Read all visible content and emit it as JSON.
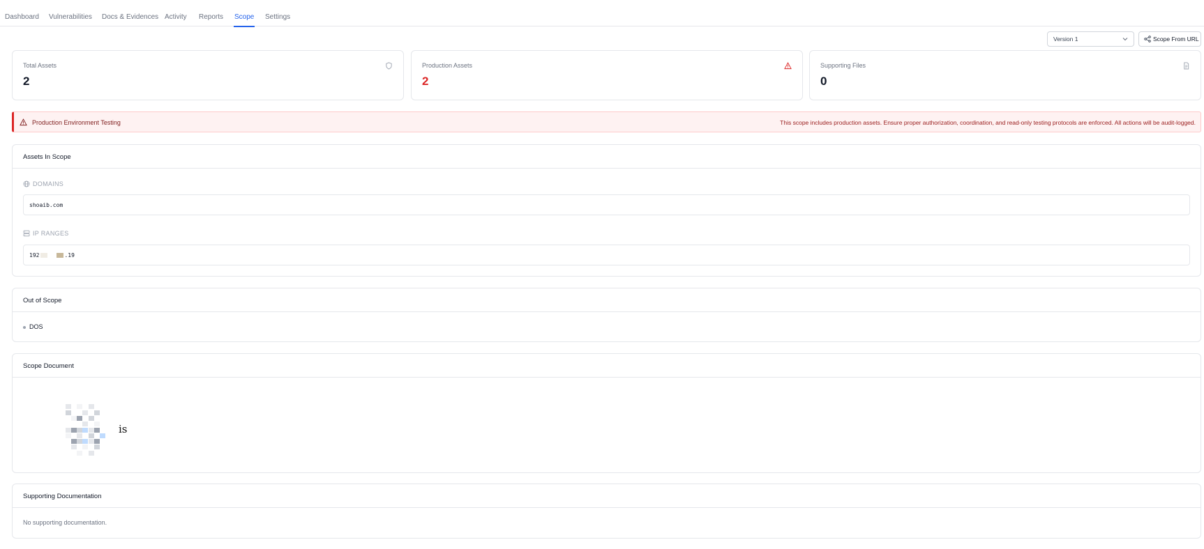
{
  "tabs": [
    {
      "label": "Dashboard",
      "active": false
    },
    {
      "label": "Vulnerabilities",
      "active": false
    },
    {
      "label": "Docs & Evidences",
      "active": false
    },
    {
      "label": "Activity",
      "active": false
    },
    {
      "label": "Reports",
      "active": false
    },
    {
      "label": "Scope",
      "active": true
    },
    {
      "label": "Settings",
      "active": false
    }
  ],
  "toolbar": {
    "version_select": "Version 1",
    "scope_from_url": "Scope From URL"
  },
  "stats": [
    {
      "label": "Total Assets",
      "value": "2",
      "icon": "shield-icon"
    },
    {
      "label": "Production Assets",
      "value": "2",
      "icon": "warning-triangle-icon",
      "color": "#dc2626"
    },
    {
      "label": "Supporting Files",
      "value": "0",
      "icon": "file-icon"
    }
  ],
  "alert": {
    "title": "Production Environment Testing",
    "message": "This scope includes production assets. Ensure proper authorization, coordination, and read-only testing protocols are enforced. All actions will be audit-logged."
  },
  "assets_in_scope": {
    "title": "Assets In Scope",
    "domains_label": "DOMAINS",
    "domains": [
      "shoaib.com"
    ],
    "ip_ranges_label": "IP RANGES",
    "ip_prefix": "192",
    "ip_suffix": ".19"
  },
  "out_of_scope": {
    "title": "Out of Scope",
    "items": [
      "DOS"
    ]
  },
  "scope_document": {
    "title": "Scope Document",
    "visible_text": "is"
  },
  "supporting_documentation": {
    "title": "Supporting Documentation",
    "empty_text": "No supporting documentation."
  },
  "colors": {
    "accent": "#2563eb",
    "danger": "#dc2626",
    "alert_bg": "#fef2f2",
    "border": "#e5e7eb"
  }
}
